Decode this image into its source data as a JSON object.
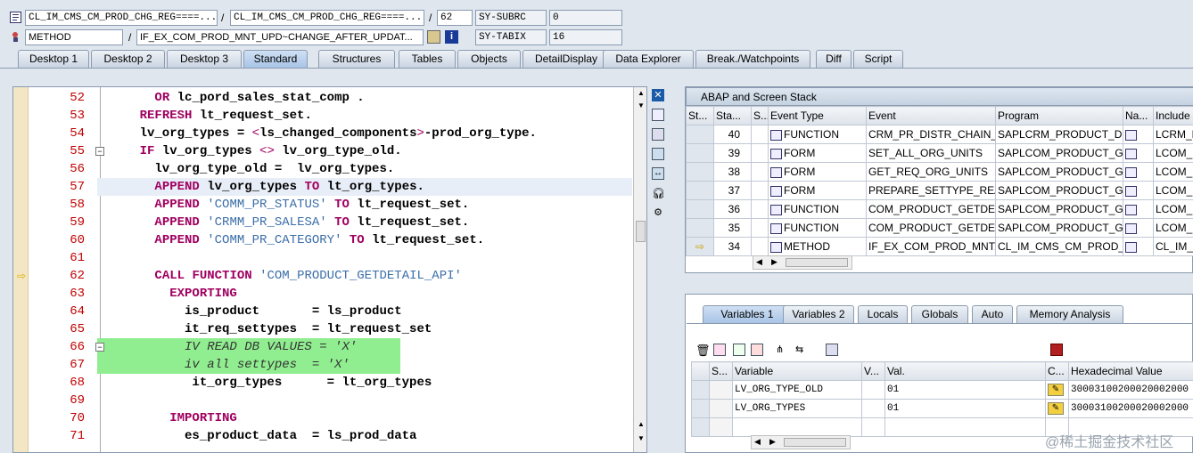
{
  "header": {
    "row1": {
      "class1": "CL_IM_CMS_CM_PROD_CHG_REG====...",
      "sep1": "/",
      "class2": "CL_IM_CMS_CM_PROD_CHG_REG====...",
      "sep2": "/",
      "line": "62",
      "sysvar": "SY-SUBRC",
      "sysval": "0"
    },
    "row2": {
      "type": "METHOD",
      "sep": "/",
      "method": "IF_EX_COM_PROD_MNT_UPD~CHANGE_AFTER_UPDAT...",
      "sysvar": "SY-TABIX",
      "sysval": "16"
    }
  },
  "tabs": [
    "Desktop 1",
    "Desktop 2",
    "Desktop 3",
    "Standard",
    "Structures",
    "Tables",
    "Objects",
    "DetailDisplay",
    "Data Explorer",
    "Break./Watchpoints",
    "Diff",
    "Script"
  ],
  "code": {
    "lines": [
      {
        "n": "52",
        "t": "      OR lc_pord_sales_stat_comp ."
      },
      {
        "n": "53",
        "t": "    REFRESH lt_request_set."
      },
      {
        "n": "54",
        "t": "    lv_org_types = <ls_changed_components>-prod_org_type."
      },
      {
        "n": "55",
        "t": "    IF lv_org_types <> lv_org_type_old."
      },
      {
        "n": "56",
        "t": "      lv_org_type_old =  lv_org_types."
      },
      {
        "n": "57",
        "t": "      APPEND lv_org_types TO lt_org_types."
      },
      {
        "n": "58",
        "t": "      APPEND 'COMM_PR_STATUS' TO lt_request_set."
      },
      {
        "n": "59",
        "t": "      APPEND 'CRMM_PR_SALESA' TO lt_request_set."
      },
      {
        "n": "60",
        "t": "      APPEND 'COMM_PR_CATEGORY' TO lt_request_set."
      },
      {
        "n": "61",
        "t": ""
      },
      {
        "n": "62",
        "t": "      CALL FUNCTION 'COM_PRODUCT_GETDETAIL_API'"
      },
      {
        "n": "63",
        "t": "        EXPORTING"
      },
      {
        "n": "64",
        "t": "          is_product       = ls_product"
      },
      {
        "n": "65",
        "t": "          it_req_settypes  = lt_request_set"
      },
      {
        "n": "66",
        "t": "*         IV_READ_DB_VALUES = 'X'"
      },
      {
        "n": "67",
        "t": "*         iv_all_settypes  = 'X'"
      },
      {
        "n": "68",
        "t": "           it_org_types      = lt_org_types"
      },
      {
        "n": "69",
        "t": ""
      },
      {
        "n": "70",
        "t": "        IMPORTING"
      },
      {
        "n": "71",
        "t": "          es_product_data  = ls_prod_data"
      }
    ]
  },
  "stack": {
    "title": "ABAP and Screen Stack",
    "columns": [
      "St...",
      "Sta...",
      "S...",
      "Event Type",
      "Event",
      "Program",
      "Na...",
      "Include"
    ],
    "rows": [
      {
        "level": "40",
        "type": "FUNCTION",
        "event": "CRM_PR_DISTR_CHAIN_...",
        "program": "SAPLCRM_PRODUCT_DIS...",
        "include": "LCRM_P"
      },
      {
        "level": "39",
        "type": "FORM",
        "event": "SET_ALL_ORG_UNITS",
        "program": "SAPLCOM_PRODUCT_GE...",
        "include": "LCOM_P"
      },
      {
        "level": "38",
        "type": "FORM",
        "event": "GET_REQ_ORG_UNITS",
        "program": "SAPLCOM_PRODUCT_GE...",
        "include": "LCOM_P"
      },
      {
        "level": "37",
        "type": "FORM",
        "event": "PREPARE_SETTYPE_REA...",
        "program": "SAPLCOM_PRODUCT_GE...",
        "include": "LCOM_P"
      },
      {
        "level": "36",
        "type": "FUNCTION",
        "event": "COM_PRODUCT_GETDE...",
        "program": "SAPLCOM_PRODUCT_GE...",
        "include": "LCOM_P"
      },
      {
        "level": "35",
        "type": "FUNCTION",
        "event": "COM_PRODUCT_GETDE...",
        "program": "SAPLCOM_PRODUCT_GE...",
        "include": "LCOM_P"
      },
      {
        "level": "34",
        "type": "METHOD",
        "event": "IF_EX_COM_PROD_MNT...",
        "program": "CL_IM_CMS_CM_PROD_C...",
        "include": "CL_IM_C"
      }
    ]
  },
  "vartabs": [
    "Variables 1",
    "Variables 2",
    "Locals",
    "Globals",
    "Auto",
    "Memory Analysis"
  ],
  "vars": {
    "columns": [
      "S...",
      "Variable",
      "V...",
      "Val.",
      "C...",
      "Hexadecimal Value"
    ],
    "rows": [
      {
        "name": "LV_ORG_TYPE_OLD",
        "val": "01",
        "hex": "30003100200020002000"
      },
      {
        "name": "LV_ORG_TYPES",
        "val": "01",
        "hex": "30003100200020002000"
      }
    ]
  },
  "watermark": "@稀土掘金技术社区",
  "colors": {
    "accent": "#a8c4e6",
    "keyword": "#a00060",
    "string": "#3b6ea8",
    "linenum": "#c00000",
    "highlight": "#90ee90"
  }
}
